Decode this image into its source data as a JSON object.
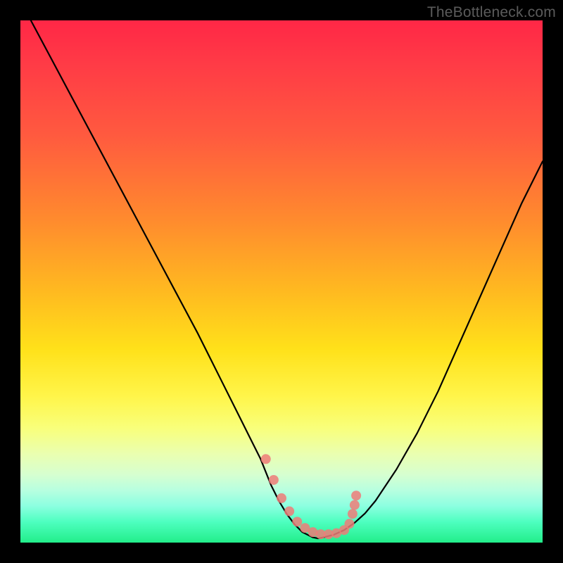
{
  "watermark": "TheBottleneck.com",
  "chart_data": {
    "type": "line",
    "title": "",
    "xlabel": "",
    "ylabel": "",
    "xlim": [
      0,
      100
    ],
    "ylim": [
      0,
      100
    ],
    "series": [
      {
        "name": "left-curve",
        "x": [
          2,
          6,
          10,
          14,
          18,
          22,
          26,
          30,
          34,
          38,
          42,
          44,
          46,
          48,
          49.5,
          51,
          52.5,
          54,
          56,
          57
        ],
        "y": [
          100,
          92.5,
          85,
          77.5,
          70,
          62.5,
          55,
          47.5,
          40,
          32,
          24,
          20,
          16,
          11,
          8,
          5.5,
          3.5,
          2,
          1,
          0.8
        ]
      },
      {
        "name": "right-curve",
        "x": [
          57,
          58,
          60,
          62,
          64,
          66,
          68,
          72,
          76,
          80,
          84,
          88,
          92,
          96,
          100
        ],
        "y": [
          0.8,
          1,
          1.5,
          2.4,
          3.8,
          5.6,
          8,
          14,
          21,
          29,
          38,
          47,
          56,
          65,
          73
        ]
      },
      {
        "name": "marker-dots",
        "type": "scatter",
        "x": [
          47,
          48.5,
          50,
          51.5,
          53,
          54.5,
          56,
          57.5,
          59,
          60.5,
          62,
          63,
          63.6,
          64,
          64.3
        ],
        "y": [
          16,
          12,
          8.5,
          6,
          4,
          2.8,
          2,
          1.6,
          1.6,
          1.8,
          2.4,
          3.6,
          5.5,
          7.2,
          9
        ]
      }
    ]
  }
}
